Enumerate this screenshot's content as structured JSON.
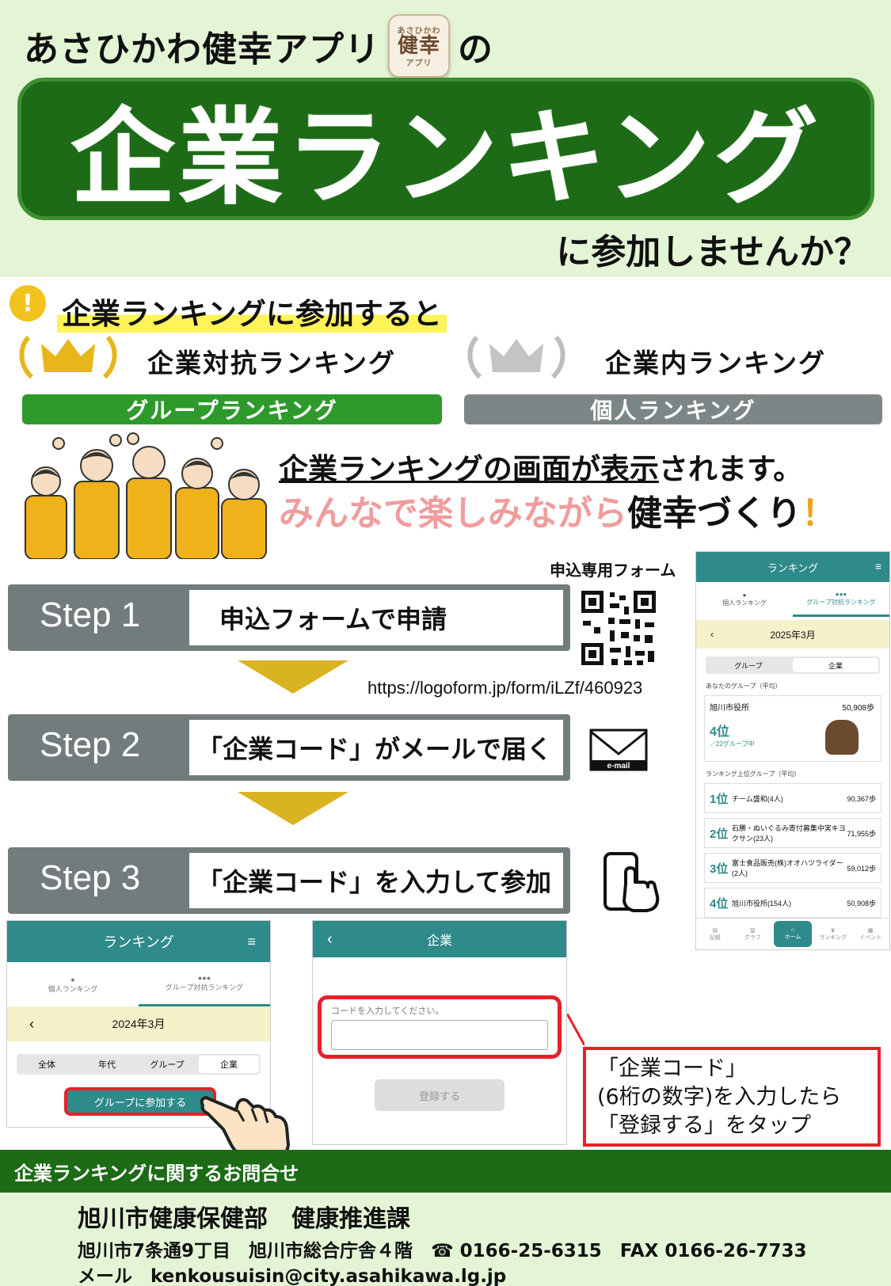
{
  "header": {
    "intro": "あさひかわ健幸アプリ",
    "intro_suffix": "の",
    "app_icon": {
      "top": "あさひかわ",
      "main": "健幸",
      "bottom": "アプリ",
      "color": "#6b4a2f"
    },
    "banner": "企業ランキング",
    "question": "に参加しませんか？",
    "bg_color": "#e4f5d6",
    "banner_color": "#1d6b17"
  },
  "benefit": {
    "title": "企業ランキングに参加すると",
    "left": {
      "label": "企業対抗ランキング",
      "pill": "グループランキング",
      "icon": "gold-crown-icon"
    },
    "right": {
      "label": "企業内ランキング",
      "pill": "個人ランキング",
      "icon": "silver-crown-icon"
    },
    "screen_line_underlined": "企業ランキングの画面が表示",
    "screen_line_rest": "されます。",
    "fun_pink": "みんなで楽しみながら",
    "fun_rest": "健幸づくり",
    "fun_excl": "！"
  },
  "steps": {
    "form_label": "申込専用フォーム",
    "url": "https://logoform.jp/form/iLZf/460923",
    "items": [
      {
        "step": "Step 1",
        "text": "申込フォームで申請",
        "icon": "qr-code-icon"
      },
      {
        "step": "Step 2",
        "text": "「企業コード」がメールで届く",
        "icon": "email-icon"
      },
      {
        "step": "Step 3",
        "text": "「企業コード」を入力して参加",
        "icon": "phone-tap-icon"
      }
    ],
    "mail_caption": "e-mail"
  },
  "mock_ranking": {
    "title": "ランキング",
    "tabs": [
      "個人ランキング",
      "グループ対抗ランキング"
    ],
    "month": "2025年3月",
    "segments": [
      "グループ",
      "企業"
    ],
    "my_group_label": "あなたのグループ（平均）",
    "my_group": {
      "name": "旭川市役所",
      "steps": "50,908歩",
      "rank": "4位",
      "of": "／22グループ中"
    },
    "top_label": "ランキング上位グループ（平均）",
    "rows": [
      {
        "rank": "1位",
        "name": "チーム盛和(4人)",
        "steps": "90,367歩"
      },
      {
        "rank": "2位",
        "name": "石勝・ぬいぐるみ寄付募集中実キヨクサン(23人)",
        "steps": "71,955歩"
      },
      {
        "rank": "3位",
        "name": "富士食品販売(株)オオハツライダー(2人)",
        "steps": "59,012歩"
      },
      {
        "rank": "4位",
        "name": "旭川市役所(154人)",
        "steps": "50,908歩"
      }
    ],
    "nav": [
      "記録",
      "グラフ",
      "ホーム",
      "ランキング",
      "イベント"
    ]
  },
  "shot_join": {
    "title": "ランキング",
    "tabs": [
      "個人ランキング",
      "グループ対抗ランキング"
    ],
    "month": "2024年3月",
    "segments": [
      "全体",
      "年代",
      "グループ",
      "企業"
    ],
    "join_button": "グループに参加する"
  },
  "shot_code": {
    "title": "企業",
    "placeholder": "コードを入力してください。",
    "register_button": "登録する"
  },
  "callout": {
    "line1": "「企業コード」",
    "line2": "(6桁の数字)を入力したら",
    "line3": "「登録する」をタップ"
  },
  "footer": {
    "bar": "企業ランキングに関するお問合せ",
    "dept": "旭川市健康保健部　健康推進課",
    "address": "旭川市7条通9丁目　旭川市総合庁舎４階　☎ 0166-25-6315　FAX 0166-26-7733",
    "email": "メール　kenkousuisin@city.asahikawa.lg.jp"
  }
}
